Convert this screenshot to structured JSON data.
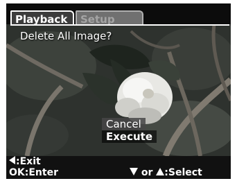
{
  "tabs": [
    {
      "label": "Playback",
      "active": true
    },
    {
      "label": "Setup",
      "active": false
    }
  ],
  "dialog": {
    "prompt": "Delete All Image?",
    "options": [
      "Cancel",
      "Execute"
    ],
    "selected_option": "Execute"
  },
  "footer": {
    "exit_icon": "left-triangle-icon",
    "exit_label": ":Exit",
    "enter_label": "OK:Enter",
    "select_down_icon": "down-triangle-icon",
    "select_or": "or",
    "select_up_icon": "up-triangle-icon",
    "select_label": ":Select"
  },
  "colors": {
    "screen_background": "#0c0c0c",
    "tab_active_background": "#3c3c3c",
    "tab_inactive_background": "#707070",
    "text": "#ffffff"
  }
}
